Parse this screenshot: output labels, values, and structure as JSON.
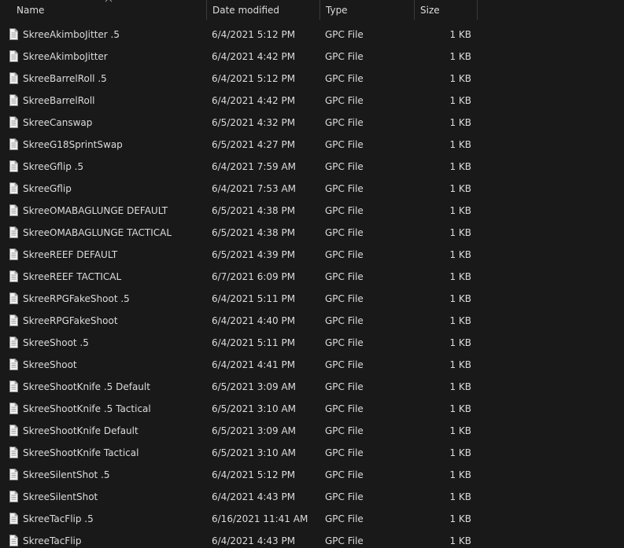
{
  "columns": {
    "name": "Name",
    "date": "Date modified",
    "type": "Type",
    "size": "Size"
  },
  "files": [
    {
      "name": "SkreeAkimboJitter .5",
      "date": "6/4/2021 5:12 PM",
      "type": "GPC File",
      "size": "1 KB"
    },
    {
      "name": "SkreeAkimboJitter",
      "date": "6/4/2021 4:42 PM",
      "type": "GPC File",
      "size": "1 KB"
    },
    {
      "name": "SkreeBarrelRoll .5",
      "date": "6/4/2021 5:12 PM",
      "type": "GPC File",
      "size": "1 KB"
    },
    {
      "name": "SkreeBarrelRoll",
      "date": "6/4/2021 4:42 PM",
      "type": "GPC File",
      "size": "1 KB"
    },
    {
      "name": "SkreeCanswap",
      "date": "6/5/2021 4:32 PM",
      "type": "GPC File",
      "size": "1 KB"
    },
    {
      "name": "SkreeG18SprintSwap",
      "date": "6/5/2021 4:27 PM",
      "type": "GPC File",
      "size": "1 KB"
    },
    {
      "name": "SkreeGflip .5",
      "date": "6/4/2021 7:59 AM",
      "type": "GPC File",
      "size": "1 KB"
    },
    {
      "name": "SkreeGflip",
      "date": "6/4/2021 7:53 AM",
      "type": "GPC File",
      "size": "1 KB"
    },
    {
      "name": "SkreeOMABAGLUNGE DEFAULT",
      "date": "6/5/2021 4:38 PM",
      "type": "GPC File",
      "size": "1 KB"
    },
    {
      "name": "SkreeOMABAGLUNGE TACTICAL",
      "date": "6/5/2021 4:38 PM",
      "type": "GPC File",
      "size": "1 KB"
    },
    {
      "name": "SkreeREEF DEFAULT",
      "date": "6/5/2021 4:39 PM",
      "type": "GPC File",
      "size": "1 KB"
    },
    {
      "name": "SkreeREEF TACTICAL",
      "date": "6/7/2021 6:09 PM",
      "type": "GPC File",
      "size": "1 KB"
    },
    {
      "name": "SkreeRPGFakeShoot .5",
      "date": "6/4/2021 5:11 PM",
      "type": "GPC File",
      "size": "1 KB"
    },
    {
      "name": "SkreeRPGFakeShoot",
      "date": "6/4/2021 4:40 PM",
      "type": "GPC File",
      "size": "1 KB"
    },
    {
      "name": "SkreeShoot .5",
      "date": "6/4/2021 5:11 PM",
      "type": "GPC File",
      "size": "1 KB"
    },
    {
      "name": "SkreeShoot",
      "date": "6/4/2021 4:41 PM",
      "type": "GPC File",
      "size": "1 KB"
    },
    {
      "name": "SkreeShootKnife .5 Default",
      "date": "6/5/2021 3:09 AM",
      "type": "GPC File",
      "size": "1 KB"
    },
    {
      "name": "SkreeShootKnife .5 Tactical",
      "date": "6/5/2021 3:10 AM",
      "type": "GPC File",
      "size": "1 KB"
    },
    {
      "name": "SkreeShootKnife Default",
      "date": "6/5/2021 3:09 AM",
      "type": "GPC File",
      "size": "1 KB"
    },
    {
      "name": "SkreeShootKnife Tactical",
      "date": "6/5/2021 3:10 AM",
      "type": "GPC File",
      "size": "1 KB"
    },
    {
      "name": "SkreeSilentShot .5",
      "date": "6/4/2021 5:12 PM",
      "type": "GPC File",
      "size": "1 KB"
    },
    {
      "name": "SkreeSilentShot",
      "date": "6/4/2021 4:43 PM",
      "type": "GPC File",
      "size": "1 KB"
    },
    {
      "name": "SkreeTacFlip .5",
      "date": "6/16/2021 11:41 AM",
      "type": "GPC File",
      "size": "1 KB"
    },
    {
      "name": "SkreeTacFlip",
      "date": "6/4/2021 4:43 PM",
      "type": "GPC File",
      "size": "1 KB"
    }
  ]
}
